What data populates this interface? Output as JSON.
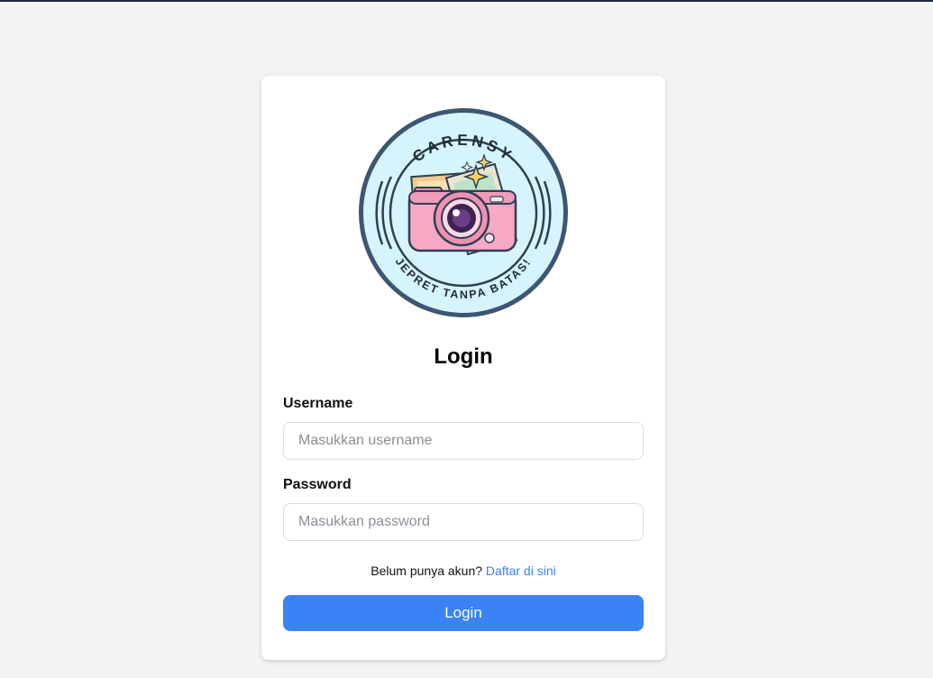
{
  "logo": {
    "top_text": "CARENSY",
    "bottom_text": "JEPRET TANPA BATAS!"
  },
  "form": {
    "title": "Login",
    "username_label": "Username",
    "username_placeholder": "Masukkan username",
    "username_value": "",
    "password_label": "Password",
    "password_placeholder": "Masukkan password",
    "password_value": "",
    "register_prompt": "Belum punya akun?",
    "register_link": "Daftar di sini",
    "submit_label": "Login"
  },
  "colors": {
    "page_background": "#f2f3f5",
    "card_background": "#ffffff",
    "accent": "#3b82f6",
    "logo_ring": "#3e5573",
    "logo_fill": "#d6f4fb",
    "camera_body": "#f7a8c4"
  },
  "icons": [
    "camera-icon",
    "sparkle-icon"
  ]
}
